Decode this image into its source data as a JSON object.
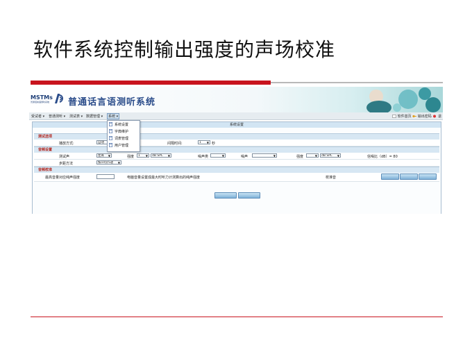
{
  "slide": {
    "title": "软件系统控制输出强度的声场校准"
  },
  "app": {
    "logo_text": "MSTMs",
    "logo_subtitle": "普通话言语测听系统",
    "title": "普通话言语测听系统"
  },
  "menu": {
    "items": [
      "受试者 ▾",
      "普通测听 ▾",
      "测试表 ▾",
      "数据管理 ▾",
      "系统 ▾"
    ],
    "top_links": [
      "软件首页",
      "输出密码",
      "退"
    ]
  },
  "dropdown": {
    "items": [
      "系统设置",
      "字典维护",
      "词表管理",
      "用户管理"
    ]
  },
  "panel": {
    "header": "系统设置",
    "sections": {
      "test_options": "测试选项",
      "audio_settings": "音频设置",
      "audio_calibration": "音频校准"
    },
    "test_options": {
      "play_mode_label": "播放方式:",
      "play_mode_value": "自动",
      "interval_label": "间隔时间:",
      "interval_value": "1",
      "interval_unit": "秒"
    },
    "audio_settings": {
      "tts_label": "测试声",
      "tts_value": "左耳",
      "intensity_label": "强度",
      "intensity_value": "1",
      "intensity_unit": "dB SPL",
      "masking_type_label": "噪声类",
      "noise_label": "噪声",
      "noise_intensity_label": "强度",
      "noise_unit": "dB SPL",
      "snr_label": "信噪比（dB）= 80",
      "step_label": "步距方法",
      "step_value": "按10分5递"
    },
    "calibration": {
      "max_level_label": "最高音量对应纯声强度",
      "max_level_value": "",
      "note": "电脑音量设置成最大时听力计测算出的纯声强度",
      "calib_label": "校准音",
      "buttons": [
        "",
        "",
        ""
      ],
      "bottom_buttons": [
        "",
        ""
      ]
    }
  }
}
